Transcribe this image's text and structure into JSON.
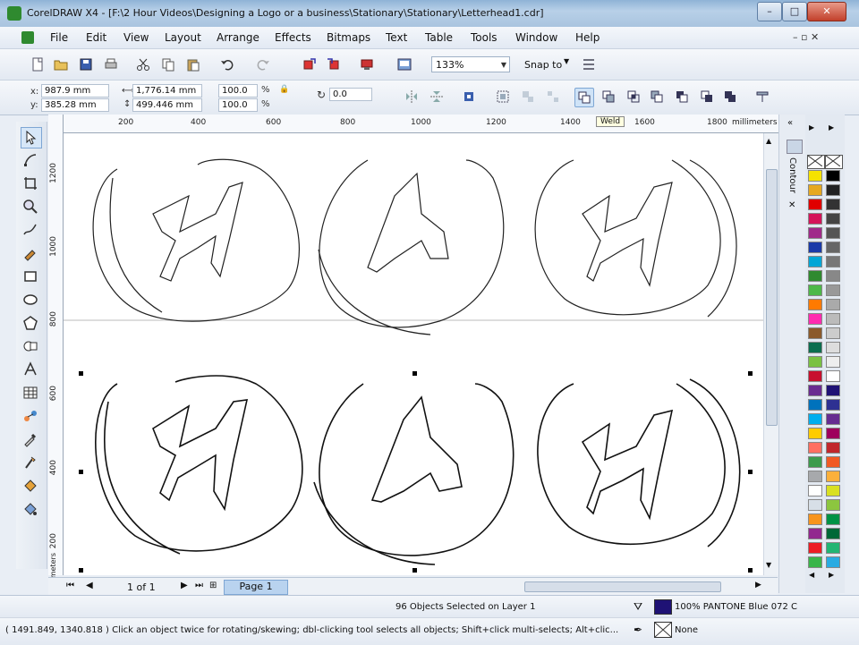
{
  "window": {
    "title": "CorelDRAW X4 - [F:\\2 Hour Videos\\Designing a Logo or a business\\Stationary\\Stationary\\Letterhead1.cdr]",
    "minimize": "–",
    "maximize": "□",
    "close": "✕"
  },
  "menu": [
    "File",
    "Edit",
    "View",
    "Layout",
    "Arrange",
    "Effects",
    "Bitmaps",
    "Text",
    "Table",
    "Tools",
    "Window",
    "Help"
  ],
  "toolbar": {
    "zoom": "133%",
    "snap_to": "Snap to"
  },
  "property_bar": {
    "x_label": "x:",
    "x_value": "987.9 mm",
    "y_label": "y:",
    "y_value": "385.28 mm",
    "width_value": "1,776.14 mm",
    "height_value": "499.446 mm",
    "scale_x": "100.0",
    "scale_y": "100.0",
    "percent": "%",
    "rotation": "0.0",
    "tooltip": "Weld"
  },
  "rulers": {
    "top": [
      "200",
      "400",
      "600",
      "800",
      "1000",
      "1200",
      "1400",
      "1600",
      "1800"
    ],
    "unit": "millimeters",
    "left": [
      "1200",
      "1000",
      "800",
      "600",
      "400",
      "200"
    ],
    "left_unit": "millimeters"
  },
  "docker": {
    "tab_label": "Contour",
    "close": "✕"
  },
  "page_nav": {
    "page_counter": "1 of 1",
    "page_tab": "Page 1"
  },
  "status": {
    "selection": "96 Objects Selected on Layer 1",
    "fill_name": "100% PANTONE Blue 072 C",
    "outline_name": "None",
    "coords_hint": "( 1491.849, 1340.818 )  Click an object twice for rotating/skewing; dbl-clicking tool selects all objects; Shift+click multi-selects; Alt+clic..."
  },
  "colors": {
    "fill_swatch": "#1f1275",
    "palette": [
      "#ffffff",
      "#e00000",
      "#f6e200",
      "#e6a820",
      "#2f8a2f",
      "#1a3aa8",
      "#a02a8a",
      "#00a6d6",
      "#ff7a00",
      "#ff2bb0"
    ]
  }
}
